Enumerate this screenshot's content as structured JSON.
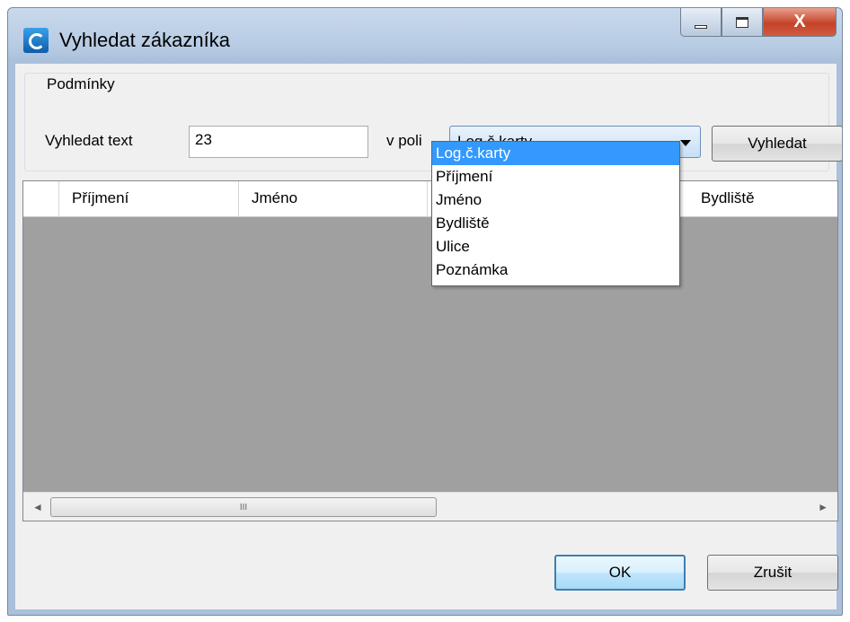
{
  "window": {
    "title": "Vyhledat zákazníka",
    "accent": "#c4432a",
    "close_glyph": "X",
    "maximize_glyph": "",
    "minimize_glyph": ""
  },
  "group": {
    "title": "Podmínky",
    "search_label": "Vyhledat text",
    "search_value": "23",
    "field_label": "v poli",
    "field_selected": "Log.č.karty",
    "search_button": "Vyhledat"
  },
  "dropdown": {
    "options": [
      "Log.č.karty",
      "Příjmení",
      "Jméno",
      "Bydliště",
      "Ulice",
      "Poznámka"
    ],
    "selected_index": 0,
    "highlight_color": "#3399ff"
  },
  "grid": {
    "columns": [
      "Příjmení",
      "Jméno",
      "Bydliště"
    ],
    "background": "#a0a0a0",
    "scroll_left": "◄",
    "scroll_right": "►",
    "scroll_grip": "III"
  },
  "footer": {
    "ok_label": "OK",
    "cancel_label": "Zrušit"
  }
}
